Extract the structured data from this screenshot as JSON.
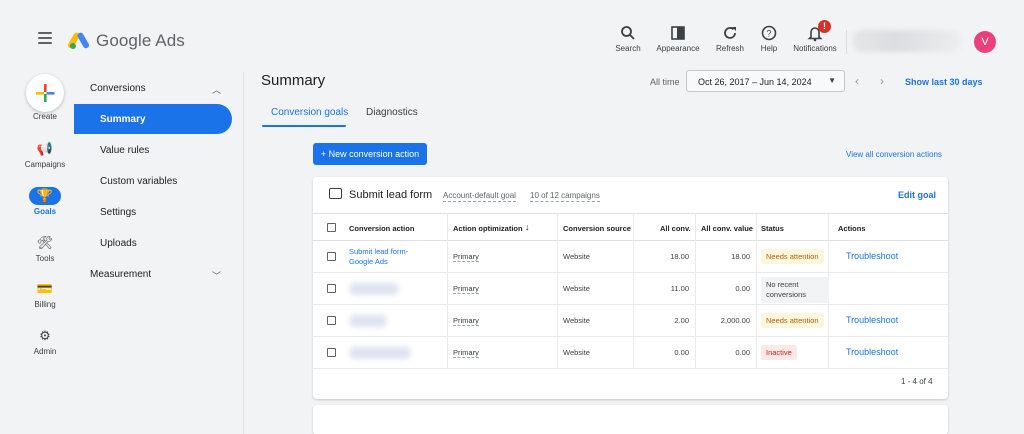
{
  "app": {
    "name": "Google Ads"
  },
  "topbar": {
    "icons": [
      {
        "icon": "search-icon",
        "label": "Search"
      },
      {
        "icon": "appearance-icon",
        "label": "Appearance"
      },
      {
        "icon": "refresh-icon",
        "label": "Refresh"
      },
      {
        "icon": "help-icon",
        "label": "Help"
      },
      {
        "icon": "notifications-icon",
        "label": "Notifications",
        "badge": "!"
      }
    ],
    "avatar_initial": "V"
  },
  "rail": {
    "items": [
      {
        "label": "Create",
        "icon": "create-plus-icon"
      },
      {
        "label": "Campaigns",
        "icon": "megaphone-icon"
      },
      {
        "label": "Goals",
        "icon": "trophy-icon"
      },
      {
        "label": "Tools",
        "icon": "tools-icon"
      },
      {
        "label": "Billing",
        "icon": "credit-card-icon"
      },
      {
        "label": "Admin",
        "icon": "gear-icon"
      }
    ]
  },
  "subnav": {
    "section_conversions": "Conversions",
    "items": [
      "Summary",
      "Value rules",
      "Custom variables",
      "Settings",
      "Uploads"
    ],
    "section_measurement": "Measurement"
  },
  "header": {
    "title": "Summary",
    "all_time": "All time",
    "date_range": "Oct 26, 2017 – Jun 14, 2024",
    "show_last": "Show last 30 days"
  },
  "tabs": [
    "Conversion goals",
    "Diagnostics"
  ],
  "actions": {
    "new_conversion": "+ New conversion action",
    "view_all": "View all conversion actions"
  },
  "goal_card": {
    "title": "Submit lead form",
    "meta_default": "Account-default goal",
    "meta_campaigns": "10 of 12 campaigns",
    "edit": "Edit goal",
    "columns": [
      "Conversion action",
      "Action optimization",
      "Conversion source",
      "All conv.",
      "All conv. value",
      "Status",
      "Actions"
    ],
    "rows": [
      {
        "name": "Submit lead form-Google Ads",
        "optimization": "Primary",
        "source": "Website",
        "all_conv": "18.00",
        "value": "18.00",
        "status": "Needs attention",
        "action": "Troubleshoot"
      },
      {
        "name": "",
        "optimization": "Primary",
        "source": "Website",
        "all_conv": "11.00",
        "value": "0.00",
        "status": "No recent conversions",
        "action": ""
      },
      {
        "name": "",
        "optimization": "Primary",
        "source": "Website",
        "all_conv": "2.00",
        "value": "2,000.00",
        "status": "Needs attention",
        "action": "Troubleshoot"
      },
      {
        "name": "",
        "optimization": "Primary",
        "source": "Website",
        "all_conv": "0.00",
        "value": "0.00",
        "status": "Inactive",
        "action": "Troubleshoot"
      }
    ],
    "pagination": "1 - 4 of 4"
  },
  "colors": {
    "accent": "#1a73e8",
    "attention_bg": "#fef7e0",
    "inactive_bg": "#fce8e6",
    "avatar": "#ec407a"
  }
}
